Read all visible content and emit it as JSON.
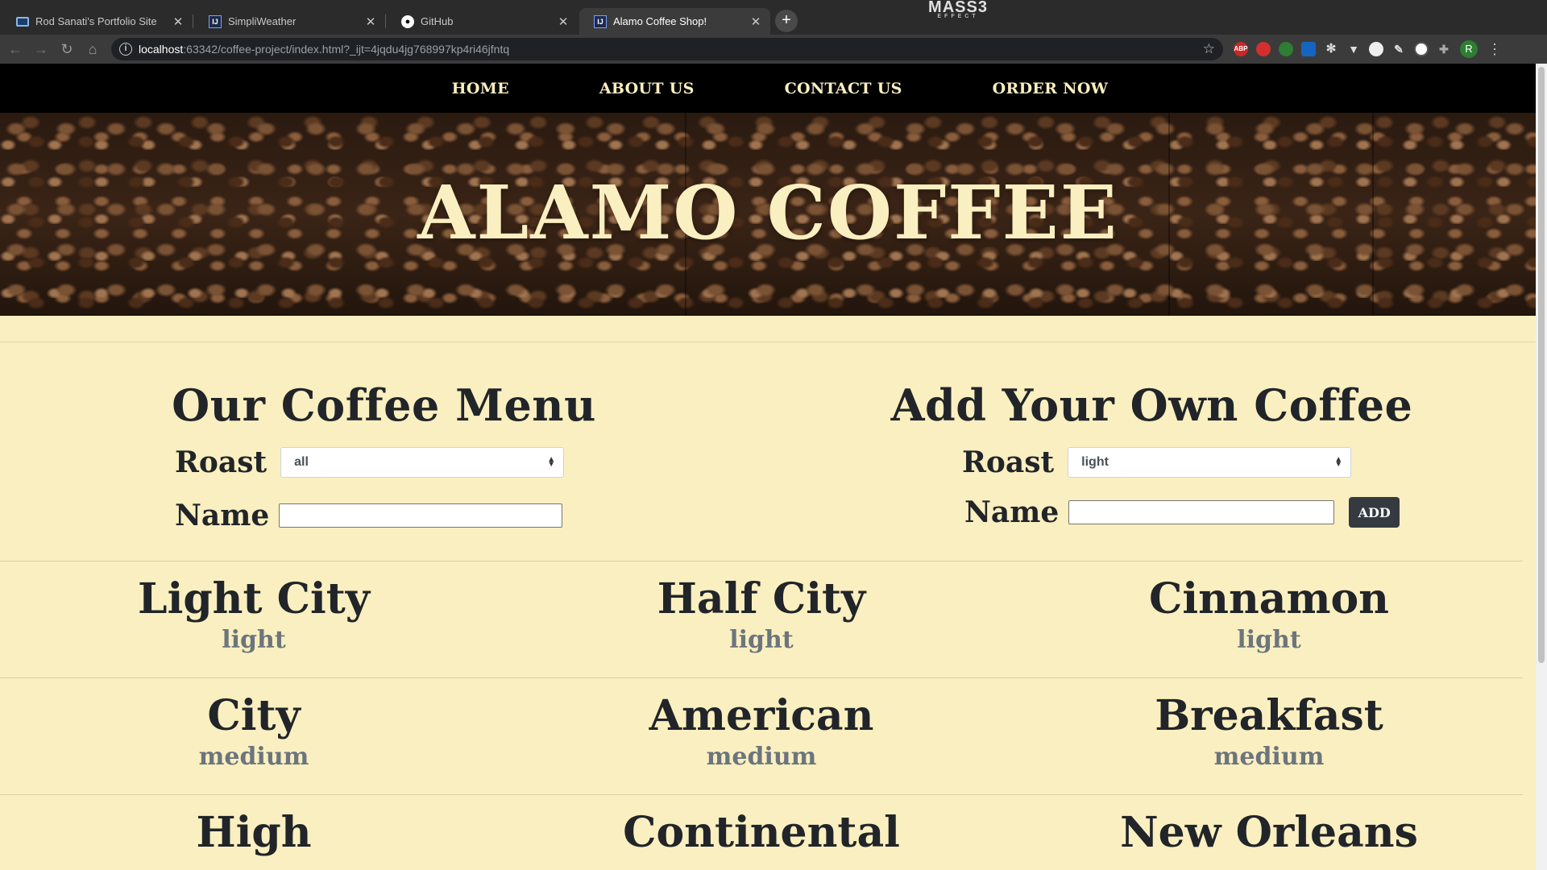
{
  "browser": {
    "tabs": [
      {
        "title": "Rod Sanati's Portfolio Site",
        "icon": "monitor-icon",
        "active": false
      },
      {
        "title": "SimpliWeather",
        "icon": "intellij-icon",
        "active": false
      },
      {
        "title": "GitHub",
        "icon": "github-icon",
        "active": false
      },
      {
        "title": "Alamo Coffee Shop!",
        "icon": "intellij-icon",
        "active": true
      }
    ],
    "new_tab_label": "+",
    "theme_logo": "MASS3",
    "theme_logo_sub": "EFFECT",
    "url_host": "localhost",
    "url_path": ":63342/coffee-project/index.html?_ijt=4jqdu4jg768997kp4ri46jfntq",
    "extensions": [
      "ABP",
      "",
      "",
      "",
      "",
      "",
      "",
      "",
      "",
      ""
    ],
    "profile_initial": "R"
  },
  "nav": {
    "items": [
      "HOME",
      "ABOUT US",
      "CONTACT US",
      "ORDER NOW"
    ]
  },
  "hero": {
    "title": "ALAMO COFFEE"
  },
  "menu_form": {
    "heading": "Our Coffee Menu",
    "roast_label": "Roast",
    "roast_value": "all",
    "name_label": "Name",
    "name_value": ""
  },
  "add_form": {
    "heading": "Add Your Own Coffee",
    "roast_label": "Roast",
    "roast_value": "light",
    "name_label": "Name",
    "name_value": "",
    "add_label": "ADD"
  },
  "coffees": [
    [
      {
        "name": "Light City",
        "roast": "light"
      },
      {
        "name": "Half City",
        "roast": "light"
      },
      {
        "name": "Cinnamon",
        "roast": "light"
      }
    ],
    [
      {
        "name": "City",
        "roast": "medium"
      },
      {
        "name": "American",
        "roast": "medium"
      },
      {
        "name": "Breakfast",
        "roast": "medium"
      }
    ],
    [
      {
        "name": "High",
        "roast": ""
      },
      {
        "name": "Continental",
        "roast": ""
      },
      {
        "name": "New Orleans",
        "roast": ""
      }
    ]
  ],
  "colors": {
    "page_bg": "#faefc0",
    "nav_bg": "#000000",
    "heading_text": "#212529",
    "roast_text": "#6c757d",
    "button_bg": "#343a40"
  }
}
